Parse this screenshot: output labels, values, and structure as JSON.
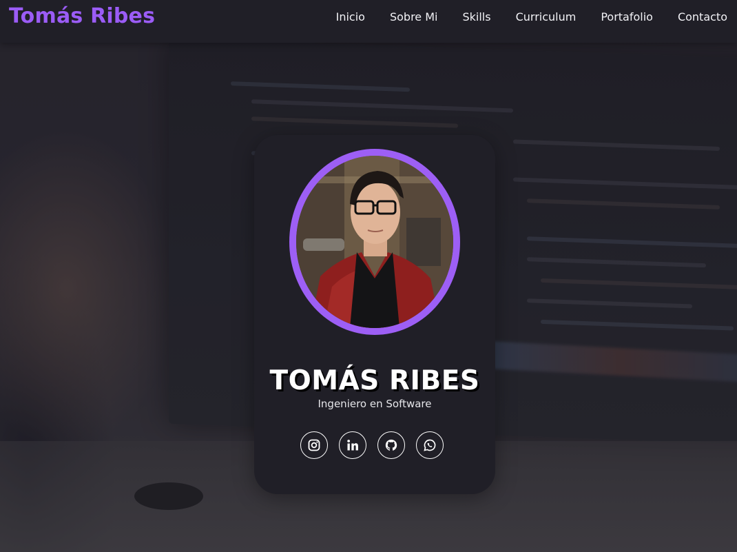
{
  "header": {
    "logo": "Tomás Ribes",
    "nav": [
      "Inicio",
      "Sobre Mi",
      "Skills",
      "Curriculum",
      "Portafolio",
      "Contacto"
    ]
  },
  "card": {
    "name": "TOMÁS RIBES",
    "role": "Ingeniero en Software",
    "socials": [
      "instagram-icon",
      "linkedin-icon",
      "github-icon",
      "whatsapp-icon"
    ]
  },
  "colors": {
    "accent": "#9b5cf6",
    "header_bg": "#201f27",
    "card_bg": "#201f27",
    "text": "#ffffff"
  }
}
